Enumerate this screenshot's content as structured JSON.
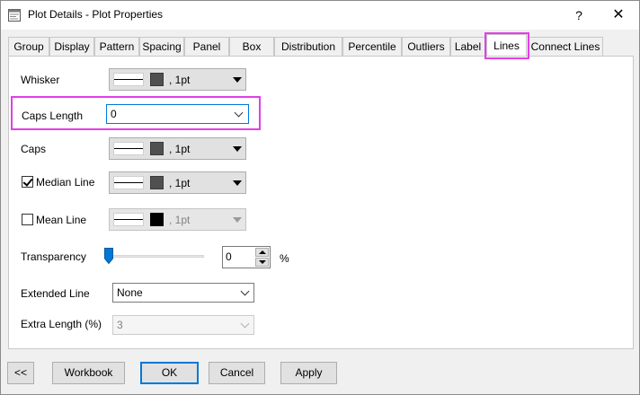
{
  "window": {
    "title": "Plot Details - Plot Properties",
    "help_label": "?",
    "close_label": "✕"
  },
  "tabs": [
    {
      "label": "Group"
    },
    {
      "label": "Display"
    },
    {
      "label": "Pattern"
    },
    {
      "label": "Spacing"
    },
    {
      "label": "Panel"
    },
    {
      "label": "Box"
    },
    {
      "label": "Distribution"
    },
    {
      "label": "Percentile"
    },
    {
      "label": "Outliers"
    },
    {
      "label": "Label"
    },
    {
      "label": "Lines",
      "active": true
    },
    {
      "label": "Connect Lines"
    }
  ],
  "lines_tab": {
    "whisker": {
      "label": "Whisker",
      "width": ", 1pt"
    },
    "caps_length": {
      "label": "Caps Length",
      "value": "0"
    },
    "caps": {
      "label": "Caps",
      "width": ", 1pt"
    },
    "median_line": {
      "label": "Median Line",
      "checked": true,
      "width": ", 1pt"
    },
    "mean_line": {
      "label": "Mean Line",
      "checked": false,
      "width": ", 1pt"
    },
    "transparency": {
      "label": "Transparency",
      "value": "0",
      "unit": "%",
      "level_percent": 0
    },
    "extended_line": {
      "label": "Extended Line",
      "value": "None"
    },
    "extra_length": {
      "label": "Extra Length (%)",
      "value": "3"
    }
  },
  "buttons": {
    "collapse": "<<",
    "workbook": "Workbook",
    "ok": "OK",
    "cancel": "Cancel",
    "apply": "Apply"
  },
  "colors": {
    "highlight": "#e33ee8",
    "focus": "#0078d7",
    "swatch_dark_gray": "#505050",
    "swatch_black": "#000000"
  },
  "icons": {
    "title": "plot-details-icon",
    "help": "help-icon",
    "close": "close-icon"
  }
}
